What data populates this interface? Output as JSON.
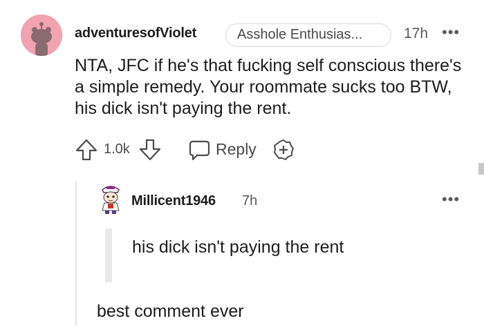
{
  "comment": {
    "author": "adventuresofViolet",
    "flair": "Asshole Enthusias...",
    "time": "17h",
    "more": "•••",
    "body": "NTA, JFC if he's that fucking self conscious there's a simple remedy. Your roommate sucks too BTW, his dick isn't paying the rent.",
    "score": "1.0k",
    "reply_label": "Reply",
    "avatar_color": "#f1a3b0"
  },
  "reply": {
    "author": "Millicent1946",
    "time": "7h",
    "more": "•••",
    "quote": "his dick isn't paying the rent",
    "body": "best comment ever"
  },
  "icons": {
    "upvote": "upvote-arrow-icon",
    "downvote": "downvote-arrow-icon",
    "reply": "speech-bubble-icon",
    "award": "award-plus-icon",
    "more": "ellipsis-icon"
  }
}
